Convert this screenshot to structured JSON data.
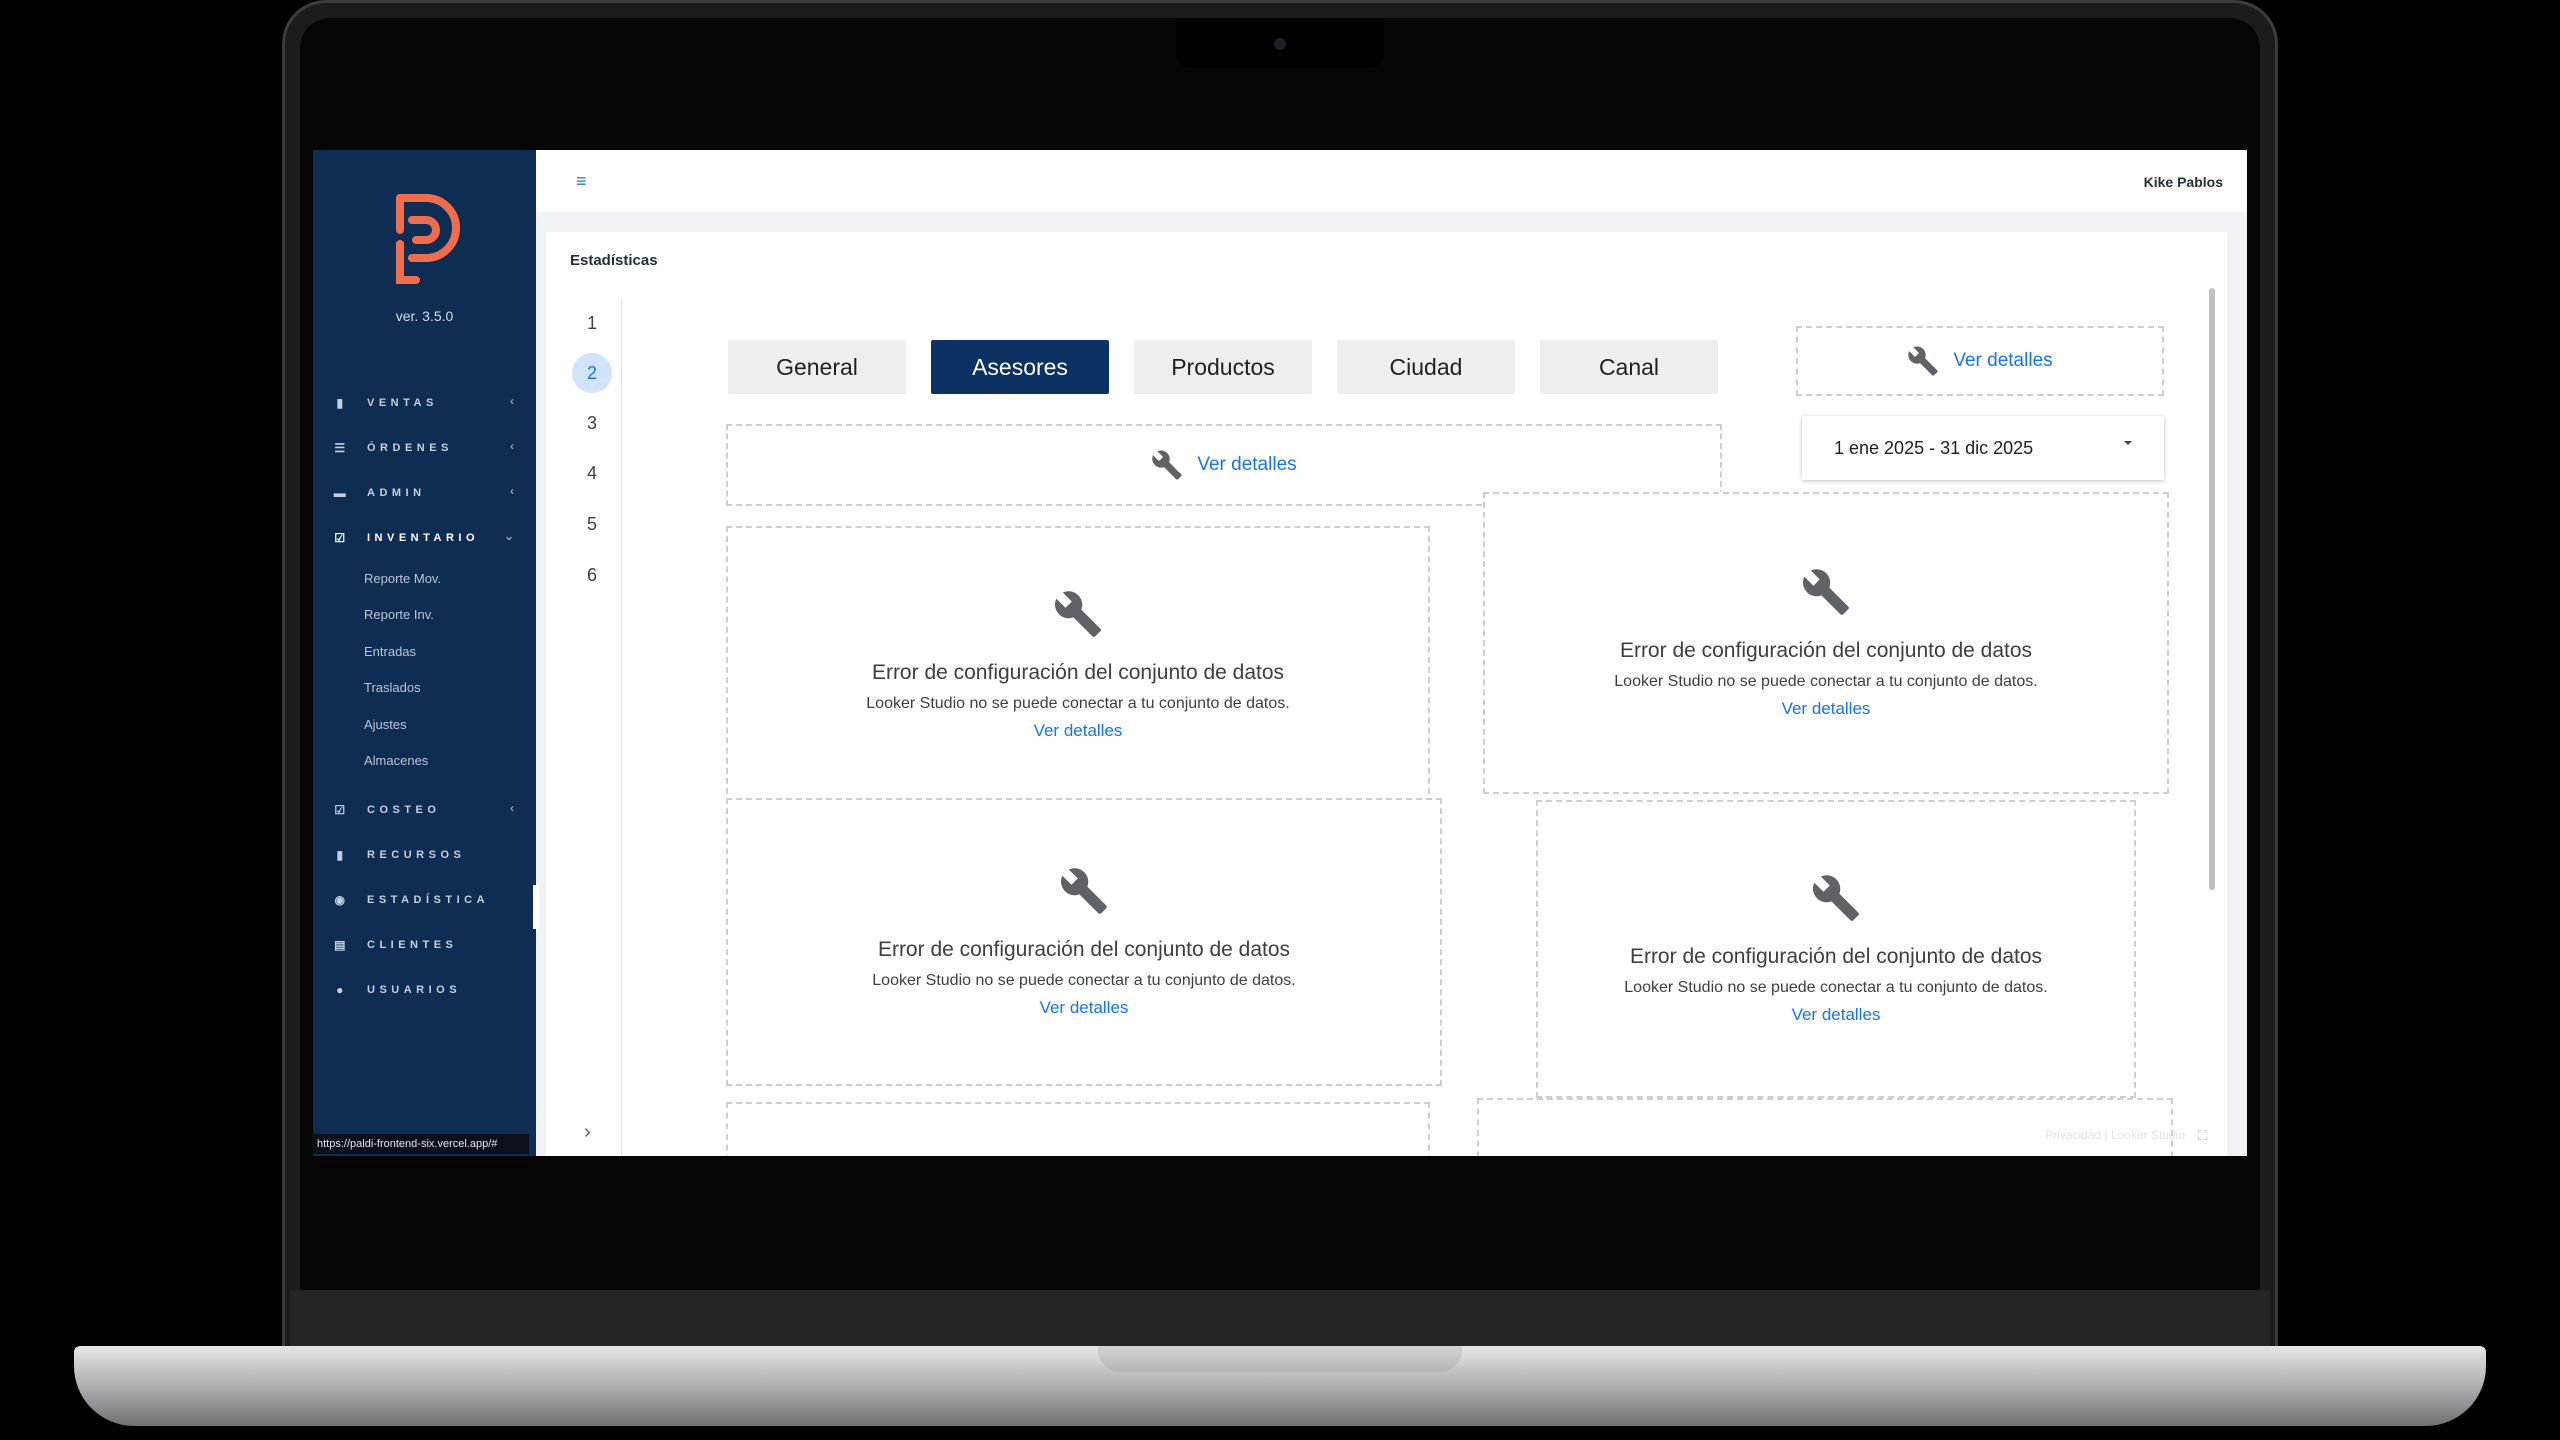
{
  "sidebar": {
    "version": "ver. 3.5.0",
    "items": [
      {
        "label": "VENTAS",
        "icon": "file-icon",
        "chevron": "‹"
      },
      {
        "label": "ÓRDENES",
        "icon": "list-icon",
        "chevron": "‹"
      },
      {
        "label": "ADMIN",
        "icon": "briefcase-icon",
        "chevron": "‹"
      },
      {
        "label": "INVENTARIO",
        "icon": "checkbox-icon",
        "chevron": "⌄"
      },
      {
        "label": "COSTEO",
        "icon": "checkbox-icon",
        "chevron": "‹"
      },
      {
        "label": "RECURSOS",
        "icon": "file-icon"
      },
      {
        "label": "ESTADÍSTICA",
        "icon": "eye-icon"
      },
      {
        "label": "CLIENTES",
        "icon": "id-card-icon"
      },
      {
        "label": "USUARIOS",
        "icon": "users-icon"
      }
    ],
    "inventario_subitems": [
      "Reporte Mov.",
      "Reporte Inv.",
      "Entradas",
      "Traslados",
      "Ajustes",
      "Almacenes"
    ],
    "status_url": "https://paldi-frontend-six.vercel.app/#"
  },
  "topbar": {
    "menu_icon": "≡",
    "user_name": "Kike Pablos"
  },
  "page": {
    "title": "Estadísticas"
  },
  "report": {
    "pages": [
      "1",
      "2",
      "3",
      "4",
      "5",
      "6"
    ],
    "active_page": "2",
    "next_icon": "›",
    "tabs": [
      "General",
      "Asesores",
      "Productos",
      "Ciudad",
      "Canal"
    ],
    "active_tab": "Asesores",
    "details_link": "Ver detalles",
    "date_range": "1 ene 2025 - 31 dic 2025",
    "error": {
      "title": "Error de configuración del conjunto de datos",
      "message": "Looker Studio no se puede conectar a tu conjunto de datos.",
      "link": "Ver detalles"
    },
    "footer": "Privacidad | Looker Studio"
  },
  "colors": {
    "sidebar_bg": "#0f2d52",
    "active_tab_bg": "#0c3163",
    "link": "#1a73e8",
    "logo": "#ef6d4f"
  }
}
